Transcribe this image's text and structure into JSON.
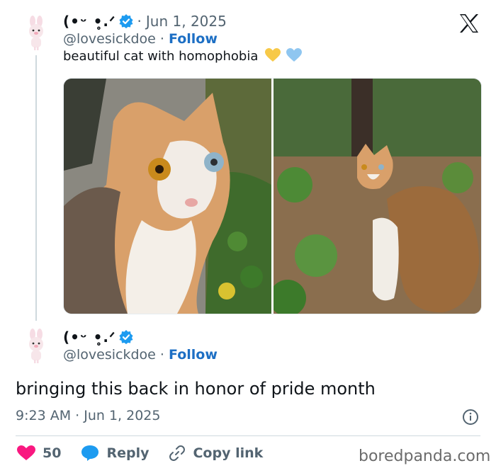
{
  "tweet1": {
    "display_name": "(•ᵕ •̥.ᐟ",
    "date": "Jun 1, 2025",
    "handle": "@lovesickdoe",
    "follow_label": "Follow",
    "text": "beautiful cat with homophobia",
    "heart_colors": [
      "#f7c948",
      "#8fc6f0"
    ]
  },
  "tweet2": {
    "display_name": "(•ᵕ •̥.ᐟ",
    "handle": "@lovesickdoe",
    "follow_label": "Follow",
    "text": "bringing this back in honor of pride month",
    "timestamp": "9:23 AM · Jun 1, 2025"
  },
  "actions": {
    "like_count": "50",
    "reply_label": "Reply",
    "copy_label": "Copy link"
  },
  "watermark": "boredpanda.com",
  "colors": {
    "accent": "#1d6fc4",
    "verified": "#1d9bf0",
    "like": "#f91880",
    "reply": "#1d9bf0"
  }
}
